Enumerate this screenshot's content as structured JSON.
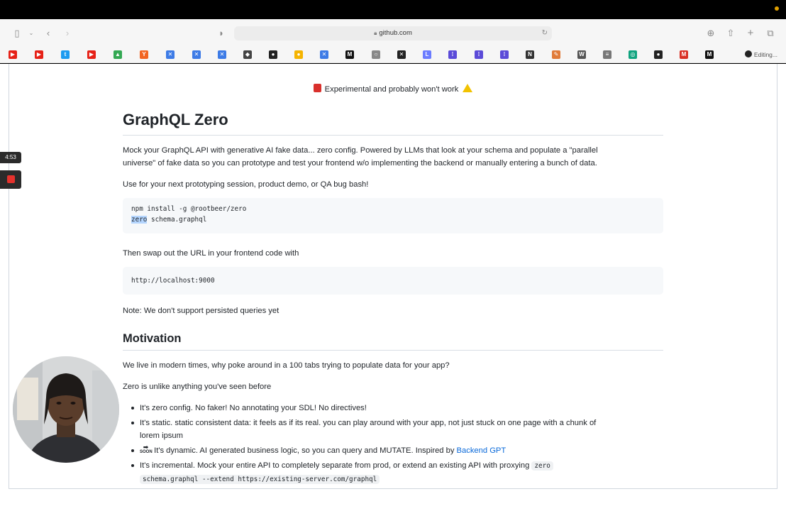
{
  "browser": {
    "url": "github.com",
    "editing_label": "Editing..."
  },
  "favorites": [
    {
      "name": "youtube-icon",
      "color": "#e62117",
      "glyph": "▶"
    },
    {
      "name": "youtube-icon",
      "color": "#e62117",
      "glyph": "▶"
    },
    {
      "name": "twitter-icon",
      "color": "#1d9bf0",
      "glyph": "t"
    },
    {
      "name": "youtube-icon",
      "color": "#e62117",
      "glyph": "▶"
    },
    {
      "name": "google-drive-icon",
      "color": "#34a853",
      "glyph": "▲"
    },
    {
      "name": "ycombinator-icon",
      "color": "#f26522",
      "glyph": "Y"
    },
    {
      "name": "x-icon",
      "color": "#3d7be6",
      "glyph": "✕"
    },
    {
      "name": "x-icon",
      "color": "#3d7be6",
      "glyph": "✕"
    },
    {
      "name": "x-icon",
      "color": "#3d7be6",
      "glyph": "✕"
    },
    {
      "name": "figma-icon",
      "color": "#444",
      "glyph": "◆"
    },
    {
      "name": "github-icon",
      "color": "#222",
      "glyph": "●"
    },
    {
      "name": "bookmark-icon",
      "color": "#f5b400",
      "glyph": "●"
    },
    {
      "name": "x-icon",
      "color": "#3d7be6",
      "glyph": "✕"
    },
    {
      "name": "medium-icon",
      "color": "#111",
      "glyph": "M"
    },
    {
      "name": "gear-icon",
      "color": "#888",
      "glyph": "○"
    },
    {
      "name": "x-icon",
      "color": "#222",
      "glyph": "✕"
    },
    {
      "name": "linear-icon",
      "color": "#6b7cff",
      "glyph": "L"
    },
    {
      "name": "slack-icon",
      "color": "#5b4bd8",
      "glyph": "⁞"
    },
    {
      "name": "slack-icon",
      "color": "#5b4bd8",
      "glyph": "⁞"
    },
    {
      "name": "slack-icon",
      "color": "#5b4bd8",
      "glyph": "⁞"
    },
    {
      "name": "notion-icon",
      "color": "#333",
      "glyph": "N"
    },
    {
      "name": "pencil-icon",
      "color": "#e07b39",
      "glyph": "✎"
    },
    {
      "name": "wikipedia-icon",
      "color": "#555",
      "glyph": "W"
    },
    {
      "name": "list-icon",
      "color": "#777",
      "glyph": "≡"
    },
    {
      "name": "openai-icon",
      "color": "#10a37f",
      "glyph": "◎"
    },
    {
      "name": "github-icon",
      "color": "#222",
      "glyph": "●"
    },
    {
      "name": "gmail-icon",
      "color": "#d93025",
      "glyph": "M"
    },
    {
      "name": "medium-icon",
      "color": "#111",
      "glyph": "M"
    }
  ],
  "recording": {
    "timer": "4:53"
  },
  "readme": {
    "banner": "Experimental and probably won't work",
    "title": "GraphQL Zero",
    "intro_line1": "Mock your GraphQL API with generative AI fake data... zero config. Powered by LLMs that look at your schema and populate a \"parallel",
    "intro_line2": "universe\" of fake data so you can prototype and test your frontend w/o implementing the backend or manually entering a bunch of data.",
    "use_for": "Use for your next prototyping session, product demo, or QA bug bash!",
    "install_cmd": "npm install -g @rootbeer/zero",
    "run_cmd_selected": "zero",
    "run_cmd_rest": " schema.graphql",
    "swap_text": "Then swap out the URL in your frontend code with",
    "localhost": "http://localhost:9000",
    "note": "Note: We don't support persisted queries yet",
    "motivation_title": "Motivation",
    "motivation_p1": "We live in modern times, why poke around in a 100 tabs trying to populate data for your app?",
    "motivation_p2": "Zero is unlike anything you've seen before",
    "bullet1": "It's zero config. No faker! No annotating your SDL! No directives!",
    "bullet2_line1": "It's static. static consistent data: it feels as if its real. you can play around with your app, not just stuck on one page with a chunk of",
    "bullet2_line2": "lorem ipsum",
    "bullet3_soon": "SOON",
    "bullet3_text": " It's dynamic. AI generated business logic, so you can query and MUTATE. Inspired by ",
    "bullet3_link": "Backend GPT",
    "bullet4_text": "It's incremental. Mock your entire API to completely separate from prod, or extend an existing API with proxying ",
    "bullet4_code1": "zero",
    "bullet4_code2": "schema.graphql --extend https://existing-server.com/graphql"
  }
}
